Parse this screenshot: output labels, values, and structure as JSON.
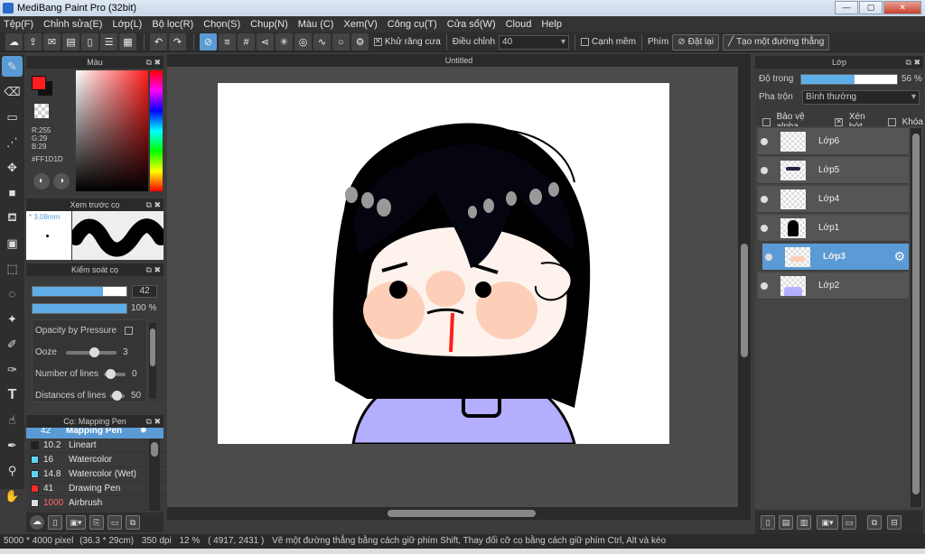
{
  "window": {
    "title": "MediBang Paint Pro (32bit)",
    "minimize": "—",
    "maximize": "▢",
    "close": "✕"
  },
  "menu": [
    "Tệp(F)",
    "Chỉnh sửa(E)",
    "Lớp(L)",
    "Bộ lọc(R)",
    "Chọn(S)",
    "Chụp(N)",
    "Màu (C)",
    "Xem(V)",
    "Công cụ(T)",
    "Cửa sổ(W)",
    "Cloud",
    "Help"
  ],
  "toolbar": {
    "antialias_label": "Khử răng cưa",
    "adjust_label": "Điều chỉnh",
    "adjust_value": "40",
    "soft_edge_label": "Cạnh mềm",
    "key_label": "Phím",
    "reset_label": "Đặt lại",
    "straight_line_label": "Tạo một đường thẳng"
  },
  "color_panel": {
    "title": "Màu",
    "r": "R:255",
    "g": "G:29",
    "b": "B:29",
    "hex": "#FF1D1D",
    "foreground": "#ff1d1d"
  },
  "brush_preview": {
    "title": "Xem trước cọ",
    "size": "* 3.08mm"
  },
  "brush_control": {
    "title": "Kiểm soát cọ",
    "size_value": "42",
    "size_fraction": 0.75,
    "opacity_value": "100 %",
    "opacity_fraction": 1.0,
    "opacity_by_pressure": "Opacity by Pressure",
    "ooze_label": "Ooze",
    "ooze_value": "3",
    "lines_label": "Number of lines",
    "lines_value": "0",
    "distance_label": "Distances of lines",
    "distance_value": "50"
  },
  "brush_list": {
    "title": "Cọ: Mapping Pen",
    "items": [
      {
        "num": "42",
        "name": "Mapping Pen",
        "color": "#ff2a2a"
      },
      {
        "num": "10.2",
        "name": "Lineart",
        "color": "#222222"
      },
      {
        "num": "16",
        "name": "Watercolor",
        "color": "#5fd3f3"
      },
      {
        "num": "14.8",
        "name": "Watercolor (Wet)",
        "color": "#5fd3f3"
      },
      {
        "num": "41",
        "name": "Drawing Pen",
        "color": "#ff2a2a"
      },
      {
        "num": "1000",
        "name": "Airbrush",
        "color": "#dddddd"
      }
    ]
  },
  "document": {
    "tab_title": "Untitled"
  },
  "layer_panel": {
    "title": "Lớp",
    "opacity_label": "Độ trong",
    "opacity_value": "56 %",
    "opacity_fraction": 0.56,
    "blend_label": "Pha trộn",
    "blend_value": "Bình thường",
    "protect_alpha": "Bảo vệ alpha",
    "clipping": "Xén bớt",
    "lock": "Khóa",
    "layers": [
      {
        "name": "Lớp6",
        "selected": false
      },
      {
        "name": "Lớp5",
        "selected": false
      },
      {
        "name": "Lớp4",
        "selected": false
      },
      {
        "name": "Lớp1",
        "selected": false
      },
      {
        "name": "Lớp3",
        "selected": true
      },
      {
        "name": "Lớp2",
        "selected": false
      }
    ]
  },
  "status": {
    "size": "5000 * 4000 pixel",
    "physical": "(36.3 * 29cm)",
    "dpi": "350 dpi",
    "zoom": "12 %",
    "coords": "( 4917, 2431 )",
    "hint": "Vẽ một đường thẳng bằng cách giữ phím Shift, Thay đổi cỡ cọ bằng cách giữ phím Ctrl, Alt và kéo"
  }
}
